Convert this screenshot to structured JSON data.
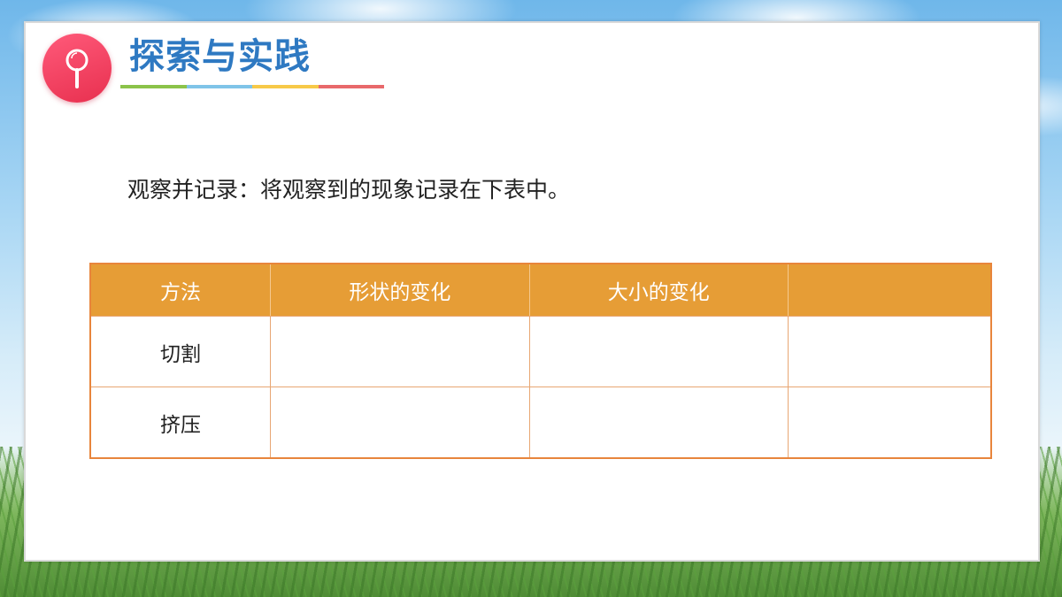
{
  "header": {
    "title": "探索与实践",
    "icon": "magnifier-icon",
    "underline_colors": [
      "#8bc34a",
      "#7fc4e8",
      "#f7c948",
      "#e8696b"
    ]
  },
  "instruction": "观察并记录：将观察到的现象记录在下表中。",
  "table": {
    "headers": [
      "方法",
      "形状的变化",
      "大小的变化",
      ""
    ],
    "rows": [
      [
        "切割",
        "",
        "",
        ""
      ],
      [
        "挤压",
        "",
        "",
        ""
      ]
    ]
  },
  "colors": {
    "title": "#2e79c2",
    "header_fill": "#e69d36",
    "table_border": "#e8853c",
    "badge": "#e8304f"
  }
}
